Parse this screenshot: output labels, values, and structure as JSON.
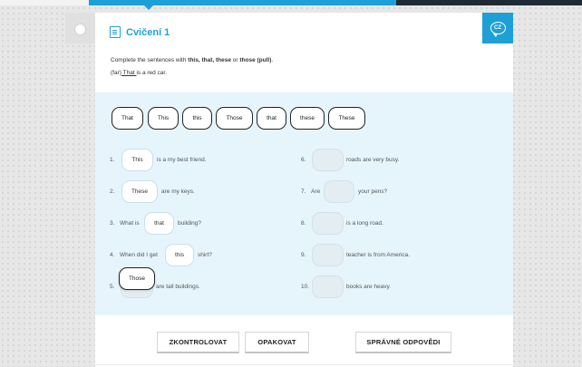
{
  "exercise": {
    "title": "Cvičení 1",
    "lang_badge": "CZ",
    "instruction": {
      "prefix": "Complete the sentences with ",
      "words": "this, that, these",
      "mid": " or ",
      "last": "those (pull)",
      "suffix": "."
    },
    "example": {
      "hint": "(far)",
      "answer": " That ",
      "rest": "is a red car."
    }
  },
  "word_bank": [
    "That",
    "This",
    "this",
    "Those",
    "that",
    "these",
    "These"
  ],
  "sentences": {
    "s1": {
      "num": "1.",
      "before": "",
      "answer": "This",
      "after": "is a my best friend."
    },
    "s2": {
      "num": "2.",
      "before": "",
      "answer": "These",
      "after": "are my keys."
    },
    "s3": {
      "num": "3.",
      "before": "What is",
      "answer": "that",
      "after": "building?"
    },
    "s4": {
      "num": "4.",
      "before": "When did I get",
      "answer": "this",
      "after": "shirt?"
    },
    "s5": {
      "num": "5.",
      "before": "",
      "answer": "",
      "after": "are tall buildings."
    },
    "s6": {
      "num": "6.",
      "before": "",
      "answer": "",
      "after": "roads are very busy."
    },
    "s7": {
      "num": "7.",
      "before": "Are",
      "answer": "",
      "after": "your pens?"
    },
    "s8": {
      "num": "8.",
      "before": "",
      "answer": "",
      "after": "is a long road."
    },
    "s9": {
      "num": "9.",
      "before": "",
      "answer": "",
      "after": "teacher is from America."
    },
    "s10": {
      "num": "10.",
      "before": "",
      "answer": "",
      "after": "books are heavy."
    }
  },
  "dragging_chip": "Those",
  "buttons": {
    "check": "ZKONTROLOVAT",
    "repeat": "OPAKOVAT",
    "answers": "SPRÁVNÉ ODPOVĚDI"
  },
  "colors": {
    "accent": "#1ea0d6",
    "work_area": "#e6f5fb",
    "topbar_dark": "#1e2a36"
  }
}
